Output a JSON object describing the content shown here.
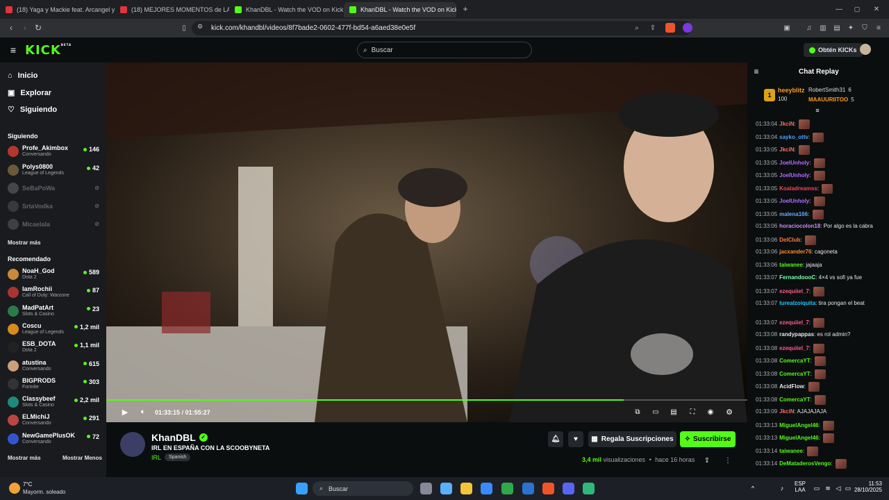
{
  "tabs": [
    {
      "label": "(18) Yaga y Mackie feat. Arcangel y d",
      "icon": "youtube-icon"
    },
    {
      "label": "(18) MEJORES MOMENTOS de LA SC",
      "icon": "youtube-icon"
    },
    {
      "label": "KhanDBL - Watch the VOD on Kick",
      "icon": "kick-icon"
    },
    {
      "label": "KhanDBL - Watch the VOD on Kick",
      "icon": "kick-icon",
      "active": true
    }
  ],
  "browser": {
    "url": "kick.com/khandbl/videos/8f7bade2-0602-477f-bd54-a6aed38e0e5f"
  },
  "header": {
    "logo": "KICK",
    "logo_badge": "BETA",
    "search_placeholder": "Buscar",
    "kicks_button": "Obtén KICKs"
  },
  "sidebar": {
    "nav": [
      {
        "label": "Inicio",
        "icon": "home-icon"
      },
      {
        "label": "Explorar",
        "icon": "compass-icon"
      },
      {
        "label": "Siguiendo",
        "icon": "heart-icon"
      }
    ],
    "following_title": "Siguiendo",
    "following": [
      {
        "name": "Profe_Akimbox",
        "category": "Conversando",
        "viewers": "146",
        "color": "#b3372d"
      },
      {
        "name": "Polys0800",
        "category": "League of Legends",
        "viewers": "42",
        "color": "#6a5a3a"
      },
      {
        "name": "SeBaPoWa",
        "offline": true,
        "color": "#888"
      },
      {
        "name": "SrtaVodka",
        "offline": true,
        "color": "#666"
      },
      {
        "name": "Micaelala",
        "offline": true,
        "color": "#777"
      }
    ],
    "show_more": "Mostrar más",
    "recommended_title": "Recomendado",
    "recommended": [
      {
        "name": "NoaH_God",
        "category": "Dota 2",
        "viewers": "589",
        "color": "#c88a3a"
      },
      {
        "name": "IamRochii",
        "category": "Call of Duty: Warzone",
        "viewers": "87",
        "color": "#a33"
      },
      {
        "name": "MadPatArt",
        "category": "Slots & Casino",
        "viewers": "23",
        "color": "#2c7a4a"
      },
      {
        "name": "Coscu",
        "category": "League of Legends",
        "viewers": "1,2 mil",
        "color": "#d88a1a"
      },
      {
        "name": "ESB_DOTA",
        "category": "Dota 2",
        "viewers": "1,1 mil",
        "color": "#222"
      },
      {
        "name": "atustina",
        "category": "Conversando",
        "viewers": "615",
        "color": "#c9a07a"
      },
      {
        "name": "BIGPRODS",
        "category": "Fortnite",
        "viewers": "303",
        "color": "#333"
      },
      {
        "name": "Classybeef",
        "category": "Slots & Casino",
        "viewers": "2,2 mil",
        "color": "#1d8a7a"
      },
      {
        "name": "ELMichiJ",
        "category": "Conversando",
        "viewers": "291",
        "color": "#b44"
      },
      {
        "name": "NewGamePlusOK",
        "category": "Conversando",
        "viewers": "72",
        "color": "#3355cc"
      }
    ],
    "show_more_bottom": "Mostrar más",
    "show_less_bottom": "Mostrar Menos"
  },
  "player": {
    "current_time": "01:33:15",
    "separator": "/",
    "duration": "01:55:27",
    "progress_fraction": 0.807
  },
  "stream": {
    "channel": "KhanDBL",
    "title": "IRL EN ESPAÑA CON LA SCOOBYNETA",
    "category": "IRL",
    "tag": "Spanish",
    "gift_button": "Regala Suscripciones",
    "subscribe_button": "Suscribirse",
    "views_count": "3,4 mil",
    "views_label": "visualizaciones",
    "age": "hace 16 horas"
  },
  "chat": {
    "title": "Chat Replay",
    "top": [
      {
        "rank": "1",
        "name": "heeyblitz",
        "amount": "100"
      },
      {
        "name": "RobertSmith31",
        "amount": "6"
      },
      {
        "name": "MAAUURIITOO",
        "amount": "5"
      }
    ],
    "messages": [
      {
        "time": "01:33:04",
        "user": "JkciN",
        "color": "#ff6b6b",
        "text": "",
        "emote": true
      },
      {
        "time": "01:33:04",
        "user": "sayko_ottv",
        "color": "#4aa3ff",
        "text": "",
        "emote": true
      },
      {
        "time": "01:33:05",
        "user": "JkciN",
        "color": "#ff6b6b",
        "text": "",
        "emote": true
      },
      {
        "time": "01:33:05",
        "user": "JoelUnholy",
        "color": "#b56bff",
        "text": "",
        "emote": true
      },
      {
        "time": "01:33:05",
        "user": "JoelUnholy",
        "color": "#b56bff",
        "text": "",
        "emote": true
      },
      {
        "time": "01:33:05",
        "user": "Koaladreamss",
        "color": "#e84a5f",
        "text": "",
        "emote": true
      },
      {
        "time": "01:33:05",
        "user": "JoelUnholy",
        "color": "#b56bff",
        "text": "",
        "emote": true
      },
      {
        "time": "01:33:05",
        "user": "malena166",
        "color": "#6aa8ff",
        "text": "",
        "emote": true
      },
      {
        "time": "01:33:06",
        "user": "horaciocolon18",
        "color": "#c48cff",
        "text": "Por algo es la cabra",
        "emote": false
      },
      {
        "time": "01:33:06",
        "user": "DelClub",
        "color": "#ff7a3a",
        "text": "",
        "emote": true
      },
      {
        "time": "01:33:06",
        "user": "jacxander76",
        "color": "#ff8a2a",
        "text": "cagoneta",
        "emote": false
      },
      {
        "time": "01:33:06",
        "user": "taiwanee",
        "color": "#53fc18",
        "text": "jajaaja",
        "emote": false
      },
      {
        "time": "01:33:07",
        "user": "FernandoooC",
        "color": "#7cffb0",
        "text": "4×4 vs sofi ya fue",
        "emote": false
      },
      {
        "time": "01:33:07",
        "user": "ezequiiel_7",
        "color": "#ff5a8a",
        "text": "",
        "emote": true
      },
      {
        "time": "01:33:07",
        "user": "turealzoiquita",
        "color": "#1ec8ff",
        "text": "tira pongan el beat",
        "emote": false
      },
      {
        "time": "01:33:07",
        "user": "ezequiiel_7",
        "color": "#ff5a8a",
        "text": "",
        "emote": true
      },
      {
        "time": "01:33:08",
        "user": "randypappas",
        "color": "#e8e8e8",
        "text": "es rol admin?",
        "emote": false
      },
      {
        "time": "01:33:08",
        "user": "ezequiiel_7",
        "color": "#ff5a8a",
        "text": "",
        "emote": true
      },
      {
        "time": "01:33:08",
        "user": "ComercaYT",
        "color": "#53fc18",
        "text": "",
        "emote": true
      },
      {
        "time": "01:33:08",
        "user": "ComercaYT",
        "color": "#53fc18",
        "text": "",
        "emote": true
      },
      {
        "time": "01:33:08",
        "user": "AcidFlow",
        "color": "#e8e8e8",
        "text": "",
        "emote": true
      },
      {
        "time": "01:33:08",
        "user": "ComercaYT",
        "color": "#53fc18",
        "text": "",
        "emote": true
      },
      {
        "time": "01:33:09",
        "user": "JkciN",
        "color": "#ff6b6b",
        "text": "AJAJAJAJA",
        "emote": false
      },
      {
        "time": "01:33:13",
        "user": "MiguelAngel46",
        "color": "#53fc18",
        "text": "",
        "emote": true
      },
      {
        "time": "01:33:13",
        "user": "MiguelAngel46",
        "color": "#53fc18",
        "text": "",
        "emote": true
      },
      {
        "time": "01:33:14",
        "user": "taiwanee",
        "color": "#53fc18",
        "text": "",
        "emote": true
      },
      {
        "time": "01:33:14",
        "user": "DeMataderosVengo",
        "color": "#53fc18",
        "text": "",
        "emote": true
      }
    ]
  },
  "taskbar": {
    "weather_temp": "7°C",
    "weather_desc": "Mayorm. soleado",
    "search": "Buscar",
    "lang_1": "ESP",
    "lang_2": "LAA",
    "time": "11:53",
    "date": "28/10/2025"
  }
}
